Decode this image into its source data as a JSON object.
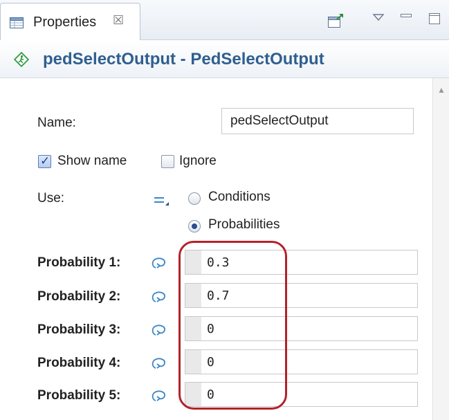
{
  "tab": {
    "label": "Properties",
    "icon": "properties-table-icon",
    "close_icon": "close-icon"
  },
  "toolbar": {
    "icons": [
      "new-view-icon",
      "view-menu-icon",
      "minimize-icon",
      "maximize-icon"
    ]
  },
  "header": {
    "title": "pedSelectOutput - PedSelectOutput",
    "icon": "pedestrian-select-output-icon"
  },
  "form": {
    "name_label": "Name:",
    "name_value": "pedSelectOutput",
    "show_name_label": "Show name",
    "show_name_checked": true,
    "ignore_label": "Ignore",
    "ignore_checked": false,
    "use_label": "Use:",
    "use_options": [
      {
        "label": "Conditions",
        "selected": false
      },
      {
        "label": "Probabilities",
        "selected": true
      }
    ],
    "probabilities": [
      {
        "label": "Probability 1:",
        "value": "0.3"
      },
      {
        "label": "Probability 2:",
        "value": "0.7"
      },
      {
        "label": "Probability 3:",
        "value": "0"
      },
      {
        "label": "Probability 4:",
        "value": "0"
      },
      {
        "label": "Probability 5:",
        "value": "0"
      }
    ]
  },
  "colors": {
    "title": "#2f5f8f",
    "highlight": "#b3222a",
    "icon_blue": "#3a86c8",
    "ped_icon_green": "#2e9b3e"
  }
}
